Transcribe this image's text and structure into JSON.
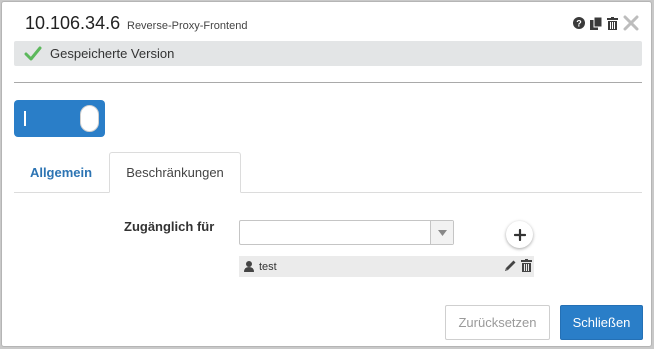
{
  "header": {
    "ip": "10.106.34.6",
    "subtitle": "Reverse-Proxy-Frontend",
    "icons": [
      "help-icon",
      "copy-icon",
      "trash-icon",
      "close-icon"
    ]
  },
  "status": {
    "text": "Gespeicherte Version",
    "icon": "check-icon",
    "color": "#5cb85c"
  },
  "toggle": {
    "state": "on",
    "color": "#2a7ec8"
  },
  "tabs": [
    {
      "label": "Allgemein",
      "active": false
    },
    {
      "label": "Beschränkungen",
      "active": true
    }
  ],
  "form": {
    "accessible_label": "Zugänglich für",
    "select_value": "",
    "entries": [
      {
        "name": "test",
        "icon": "user-icon"
      }
    ]
  },
  "buttons": {
    "reset": "Zurücksetzen",
    "close": "Schließen"
  },
  "colors": {
    "accent": "#2a7ec8",
    "link": "#2c74b3"
  }
}
